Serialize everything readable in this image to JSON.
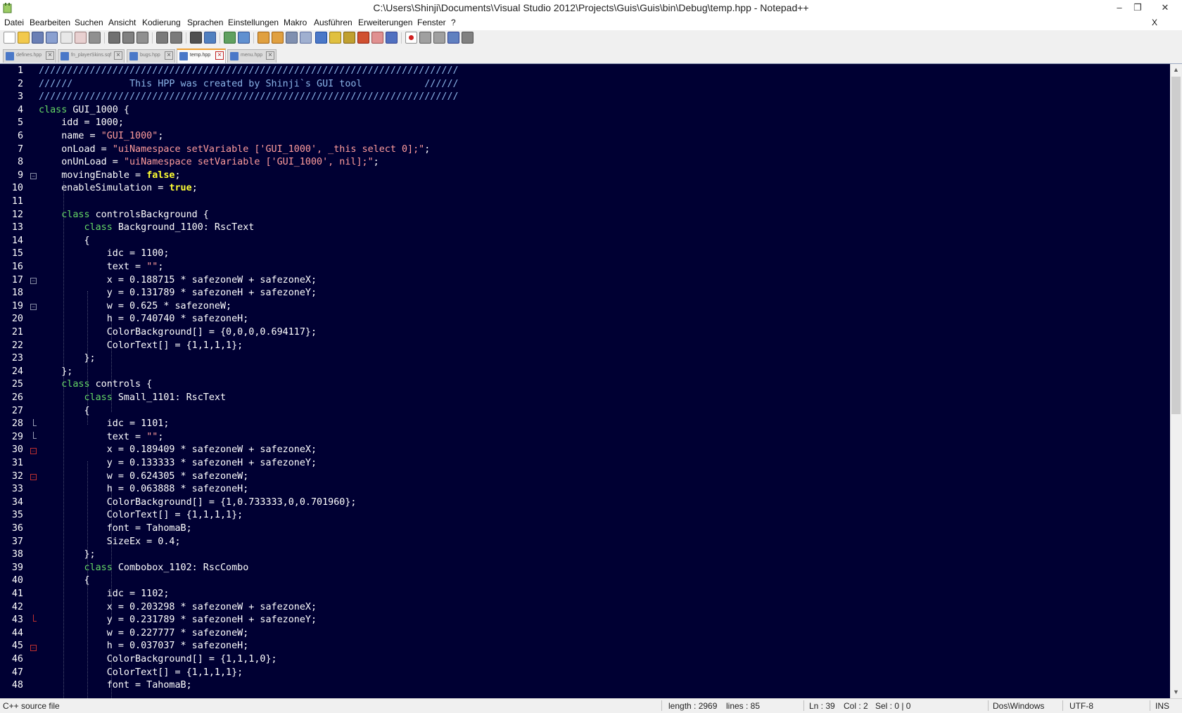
{
  "window": {
    "title": "C:\\Users\\Shinji\\Documents\\Visual Studio 2012\\Projects\\Guis\\Guis\\bin\\Debug\\temp.hpp - Notepad++",
    "minimize": "–",
    "maximize": "❐",
    "close": "✕"
  },
  "menu": {
    "items": [
      "Datei",
      "Bearbeiten",
      "Suchen",
      "Ansicht",
      "Kodierung",
      "Sprachen",
      "Einstellungen",
      "Makro",
      "Ausführen",
      "Erweiterungen",
      "Fenster",
      "?"
    ],
    "close": "X"
  },
  "tabs": [
    {
      "label": "defines.hpp",
      "active": false
    },
    {
      "label": "fn_playerSkins.sqf",
      "active": false
    },
    {
      "label": "bugs.hpp",
      "active": false
    },
    {
      "label": "temp.hpp",
      "active": true
    },
    {
      "label": "menu.hpp",
      "active": false
    }
  ],
  "editor": {
    "colors": {
      "background": "#000033",
      "comment": "#8ab4e8",
      "keyword": "#66d966",
      "constant": "#ffff33",
      "string": "#ff9c9c",
      "text": "#ffffff"
    },
    "lines": [
      {
        "n": "1",
        "code": [
          [
            "cm",
            "//////////////////////////////////////////////////////////////////////////"
          ]
        ]
      },
      {
        "n": "2",
        "code": [
          [
            "cm",
            "//////          This HPP was created by Shinji`s GUI tool           //////"
          ]
        ]
      },
      {
        "n": "3",
        "code": [
          [
            "cm",
            "//////////////////////////////////////////////////////////////////////////"
          ]
        ]
      },
      {
        "n": "4",
        "code": [
          [
            "kw",
            "class"
          ],
          [
            "",
            " GUI_1000 {"
          ]
        ]
      },
      {
        "n": "5",
        "code": [
          [
            "",
            "    idd = 1000;"
          ]
        ]
      },
      {
        "n": "6",
        "code": [
          [
            "",
            "    name = "
          ],
          [
            "str",
            "\"GUI_1000\""
          ],
          [
            "",
            ";"
          ]
        ]
      },
      {
        "n": "7",
        "code": [
          [
            "",
            "    onLoad = "
          ],
          [
            "str",
            "\"uiNamespace setVariable ['GUI_1000', _this select 0];\""
          ],
          [
            "",
            ";"
          ]
        ]
      },
      {
        "n": "8",
        "code": [
          [
            "",
            "    onUnLoad = "
          ],
          [
            "str",
            "\"uiNamespace setVariable ['GUI_1000', nil];\""
          ],
          [
            "",
            ";"
          ]
        ]
      },
      {
        "n": "9",
        "code": [
          [
            "",
            "    movingEnable = "
          ],
          [
            "kwb",
            "false"
          ],
          [
            "",
            ";"
          ]
        ]
      },
      {
        "n": "10",
        "code": [
          [
            "",
            "    enableSimulation = "
          ],
          [
            "kwb",
            "true"
          ],
          [
            "",
            ";"
          ]
        ]
      },
      {
        "n": "11",
        "code": [
          [
            "",
            ""
          ]
        ]
      },
      {
        "n": "12",
        "code": [
          [
            "",
            "    "
          ],
          [
            "kw",
            "class"
          ],
          [
            "",
            " controlsBackground {"
          ]
        ]
      },
      {
        "n": "13",
        "code": [
          [
            "",
            "        "
          ],
          [
            "kw",
            "class"
          ],
          [
            "",
            " Background_1100: RscText"
          ]
        ]
      },
      {
        "n": "14",
        "code": [
          [
            "",
            "        {"
          ]
        ]
      },
      {
        "n": "15",
        "code": [
          [
            "",
            "            idc = 1100;"
          ]
        ]
      },
      {
        "n": "16",
        "code": [
          [
            "",
            "            text = "
          ],
          [
            "str",
            "\"\""
          ],
          [
            "",
            ";"
          ]
        ]
      },
      {
        "n": "17",
        "code": [
          [
            "",
            "            x = 0.188715 * safezoneW + safezoneX;"
          ]
        ]
      },
      {
        "n": "18",
        "code": [
          [
            "",
            "            y = 0.131789 * safezoneH + safezoneY;"
          ]
        ]
      },
      {
        "n": "19",
        "code": [
          [
            "",
            "            w = 0.625 * safezoneW;"
          ]
        ]
      },
      {
        "n": "20",
        "code": [
          [
            "",
            "            h = 0.740740 * safezoneH;"
          ]
        ]
      },
      {
        "n": "21",
        "code": [
          [
            "",
            "            ColorBackground[] = {0,0,0,0.694117};"
          ]
        ]
      },
      {
        "n": "22",
        "code": [
          [
            "",
            "            ColorText[] = {1,1,1,1};"
          ]
        ]
      },
      {
        "n": "23",
        "code": [
          [
            "",
            "        };"
          ]
        ]
      },
      {
        "n": "24",
        "code": [
          [
            "",
            "    };"
          ]
        ]
      },
      {
        "n": "25",
        "code": [
          [
            "",
            "    "
          ],
          [
            "kw",
            "class"
          ],
          [
            "",
            " controls {"
          ]
        ]
      },
      {
        "n": "26",
        "code": [
          [
            "",
            "        "
          ],
          [
            "kw",
            "class"
          ],
          [
            "",
            " Small_1101: RscText"
          ]
        ]
      },
      {
        "n": "27",
        "code": [
          [
            "",
            "        {"
          ]
        ]
      },
      {
        "n": "28",
        "code": [
          [
            "",
            "            idc = 1101;"
          ]
        ]
      },
      {
        "n": "29",
        "code": [
          [
            "",
            "            text = "
          ],
          [
            "str",
            "\"\""
          ],
          [
            "",
            ";"
          ]
        ]
      },
      {
        "n": "30",
        "code": [
          [
            "",
            "            x = 0.189409 * safezoneW + safezoneX;"
          ]
        ]
      },
      {
        "n": "31",
        "code": [
          [
            "",
            "            y = 0.133333 * safezoneH + safezoneY;"
          ]
        ]
      },
      {
        "n": "32",
        "code": [
          [
            "",
            "            w = 0.624305 * safezoneW;"
          ]
        ]
      },
      {
        "n": "33",
        "code": [
          [
            "",
            "            h = 0.063888 * safezoneH;"
          ]
        ]
      },
      {
        "n": "34",
        "code": [
          [
            "",
            "            ColorBackground[] = {1,0.733333,0,0.701960};"
          ]
        ]
      },
      {
        "n": "35",
        "code": [
          [
            "",
            "            ColorText[] = {1,1,1,1};"
          ]
        ]
      },
      {
        "n": "36",
        "code": [
          [
            "",
            "            font = TahomaB;"
          ]
        ]
      },
      {
        "n": "37",
        "code": [
          [
            "",
            "            SizeEx = 0.4;"
          ]
        ]
      },
      {
        "n": "38",
        "code": [
          [
            "",
            "        };"
          ]
        ]
      },
      {
        "n": "39",
        "code": [
          [
            "",
            "        "
          ],
          [
            "kw",
            "class"
          ],
          [
            "",
            " Combobox_1102: RscCombo"
          ]
        ]
      },
      {
        "n": "40",
        "code": [
          [
            "",
            "        {"
          ]
        ]
      },
      {
        "n": "41",
        "code": [
          [
            "",
            "            idc = 1102;"
          ]
        ]
      },
      {
        "n": "42",
        "code": [
          [
            "",
            "            x = 0.203298 * safezoneW + safezoneX;"
          ]
        ]
      },
      {
        "n": "43",
        "code": [
          [
            "",
            "            y = 0.231789 * safezoneH + safezoneY;"
          ]
        ]
      },
      {
        "n": "44",
        "code": [
          [
            "",
            "            w = 0.227777 * safezoneW;"
          ]
        ]
      },
      {
        "n": "45",
        "code": [
          [
            "",
            "            h = 0.037037 * safezoneH;"
          ]
        ]
      },
      {
        "n": "46",
        "code": [
          [
            "",
            "            ColorBackground[] = {1,1,1,0};"
          ]
        ]
      },
      {
        "n": "47",
        "code": [
          [
            "",
            "            ColorText[] = {1,1,1,1};"
          ]
        ]
      },
      {
        "n": "48",
        "code": [
          [
            "",
            "            font = TahomaB;"
          ]
        ]
      }
    ]
  },
  "status": {
    "file_type": "C++ source file",
    "length": "length : 2969",
    "lines": "lines : 85",
    "ln": "Ln : 39",
    "col": "Col : 2",
    "sel": "Sel : 0 | 0",
    "eol": "Dos\\Windows",
    "encoding": "UTF-8",
    "mode": "INS"
  }
}
